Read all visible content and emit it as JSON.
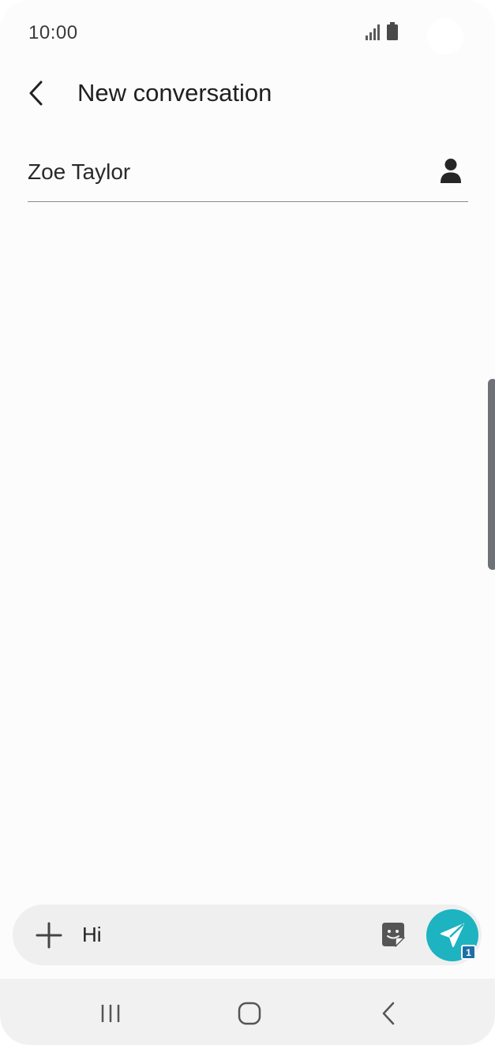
{
  "status_bar": {
    "time": "10:00"
  },
  "header": {
    "title": "New conversation"
  },
  "recipient": {
    "name": "Zoe Taylor"
  },
  "composer": {
    "message_value": "Hi",
    "sim_badge": "1"
  },
  "icons": {
    "back": "back-arrow-icon",
    "contact": "person-icon",
    "attach": "plus-icon",
    "sticker": "sticker-icon",
    "send": "send-icon",
    "nav_recents": "recents-icon",
    "nav_home": "home-icon",
    "nav_back": "nav-back-icon"
  },
  "colors": {
    "send_button": "#1db3c1",
    "sim_badge": "#1e6fa8",
    "composer_background": "#efefef"
  }
}
